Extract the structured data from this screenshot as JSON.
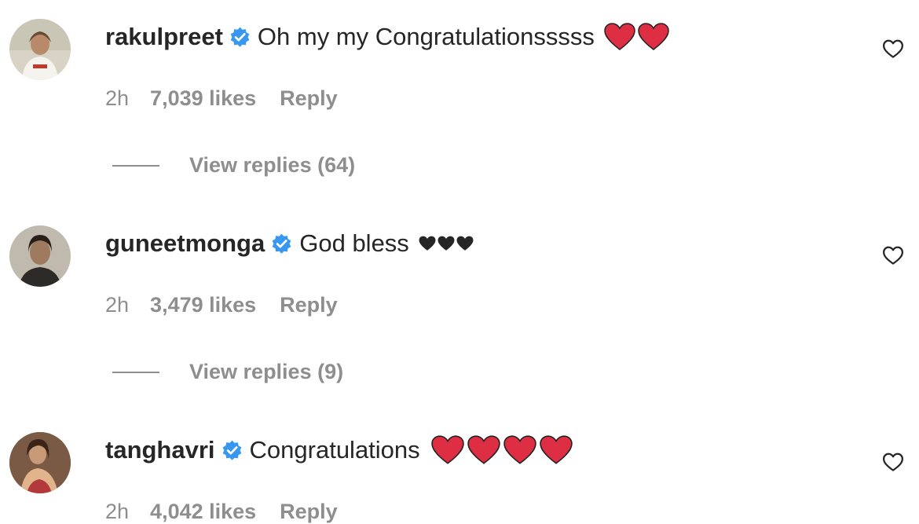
{
  "comments": [
    {
      "username": "rakulpreet",
      "text": "Oh my my Congratulationsssss",
      "time": "2h",
      "likes": "7,039 likes",
      "reply": "Reply",
      "view_replies": "View replies (64)",
      "hearts": "red-heart x2",
      "avatar_icon": "avatar-rakulpreet"
    },
    {
      "username": "guneetmonga",
      "text": "God bless",
      "time": "2h",
      "likes": "3,479 likes",
      "reply": "Reply",
      "view_replies": "View replies (9)",
      "hearts": "black-heart x3",
      "avatar_icon": "avatar-guneetmonga"
    },
    {
      "username": "tanghavri",
      "text": "Congratulations",
      "time": "2h",
      "likes": "4,042 likes",
      "reply": "Reply",
      "hearts": "red-heart x4",
      "avatar_icon": "avatar-tanghavri"
    }
  ],
  "colors": {
    "verified_blue": "#3897f0",
    "heart_red": "#dd2e44",
    "meta_gray": "#8e8e8e",
    "text_dark": "#262626"
  }
}
